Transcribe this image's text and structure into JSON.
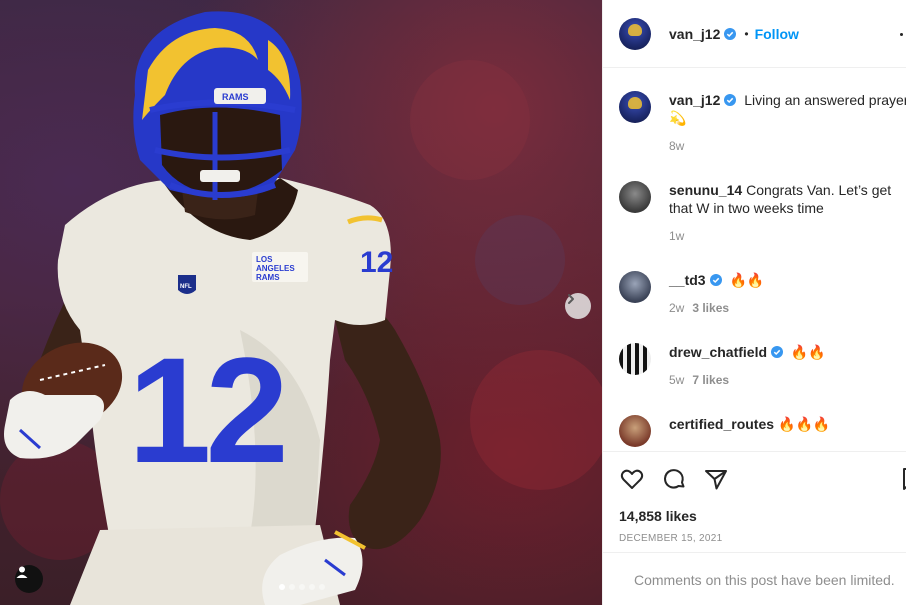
{
  "post": {
    "author": "van_j12",
    "follow_label": "Follow",
    "separator": "•",
    "caption": "Living an answered prayer",
    "caption_emoji": "💫",
    "caption_time": "8w",
    "likes": "14,858 likes",
    "date": "DECEMBER 15, 2021",
    "comments_limited": "Comments on this post have been limited.",
    "carousel": {
      "slides": 5,
      "active": 0
    }
  },
  "photo": {
    "helmet_text": "RAMS",
    "jersey_number": "12",
    "sleeve_number": "12",
    "patch_line1": "LOS",
    "patch_line2": "ANGELES",
    "patch_line3": "RAMS",
    "shield_text": "NFL"
  },
  "comments": [
    {
      "user": "senunu_14",
      "verified": false,
      "text": "Congrats Van. Let’s get that W in two weeks time",
      "time": "1w",
      "likes": ""
    },
    {
      "user": "__td3",
      "verified": true,
      "text": "🔥🔥",
      "time": "2w",
      "likes": "3 likes"
    },
    {
      "user": "drew_chatfield",
      "verified": true,
      "text": "🔥🔥",
      "time": "5w",
      "likes": "7 likes"
    },
    {
      "user": "certified_routes",
      "verified": false,
      "text": "🔥🔥🔥",
      "time": "",
      "likes": ""
    }
  ],
  "colors": {
    "accent": "#0095f6",
    "verified": "#3897f0",
    "rams_blue": "#2a3cd0",
    "rams_gold": "#f2c230",
    "jersey": "#ebe8df"
  },
  "icons": [
    "heart-icon",
    "comment-icon",
    "share-icon",
    "bookmark-icon",
    "chevron-right-icon",
    "user-tag-icon",
    "verified-icon",
    "more-icon"
  ]
}
